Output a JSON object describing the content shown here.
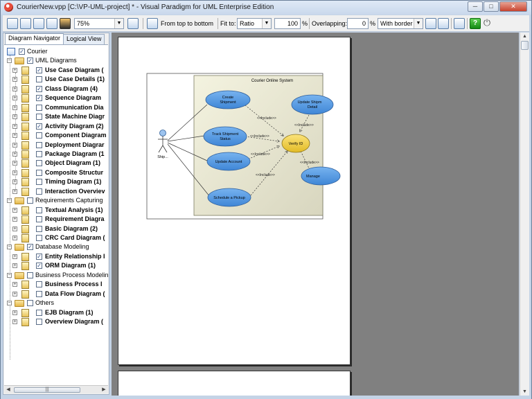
{
  "window": {
    "title": "CourierNew.vpp [C:\\VP-UML-project] * - Visual Paradigm for UML Enterprise Edition",
    "min_glyph": "─",
    "max_glyph": "□",
    "close_glyph": "✕"
  },
  "toolbar": {
    "zoom_value": "75%",
    "layout_label": "From top to bottom",
    "fit_label": "Fit to:",
    "fit_value": "Ratio",
    "fit_percent_value": "100",
    "percent_sign": "%",
    "overlap_label": "Overlapping:",
    "overlap_value": "0",
    "overlap_percent_sign": "%",
    "border_value": "With border",
    "help_glyph": "?",
    "power_glyph": "⏻",
    "dropdown_glyph": "▼"
  },
  "navigator": {
    "tabs": [
      {
        "label": "Diagram Navigator"
      },
      {
        "label": "Logical View"
      }
    ],
    "root": {
      "label": "Courier",
      "checked": true
    },
    "groups": [
      {
        "label": "UML Diagrams",
        "checked": true
      },
      {
        "label": "Requirements Capturing",
        "checked": false
      },
      {
        "label": "Database Modeling",
        "checked": true
      },
      {
        "label": "Business Process Modeling",
        "checked": false
      },
      {
        "label": "Others",
        "checked": false
      }
    ],
    "items": [
      {
        "label": "Use Case Diagram (",
        "checked": true
      },
      {
        "label": "Use Case Details (1)",
        "checked": false
      },
      {
        "label": "Class Diagram (4)",
        "checked": true
      },
      {
        "label": "Sequence Diagram",
        "checked": true
      },
      {
        "label": "Communication Dia",
        "checked": false
      },
      {
        "label": "State Machine Diagr",
        "checked": false
      },
      {
        "label": "Activity Diagram (2)",
        "checked": true
      },
      {
        "label": "Component Diagram",
        "checked": false
      },
      {
        "label": "Deployment Diagrar",
        "checked": false
      },
      {
        "label": "Package Diagram (1",
        "checked": false
      },
      {
        "label": "Object Diagram (1)",
        "checked": false
      },
      {
        "label": "Composite Structur",
        "checked": false
      },
      {
        "label": "Timing Diagram (1)",
        "checked": false
      },
      {
        "label": "Interaction Overviev",
        "checked": false
      },
      {
        "label": "Textual Analysis (1)",
        "checked": false
      },
      {
        "label": "Requirement Diagra",
        "checked": false
      },
      {
        "label": "Basic Diagram (2)",
        "checked": false
      },
      {
        "label": "CRC Card Diagram (",
        "checked": false
      },
      {
        "label": "Entity Relationship I",
        "checked": true
      },
      {
        "label": "ORM Diagram (1)",
        "checked": true
      },
      {
        "label": "Business Process I",
        "checked": false
      },
      {
        "label": "Data Flow Diagram (",
        "checked": false
      },
      {
        "label": "EJB Diagram (1)",
        "checked": false
      },
      {
        "label": "Overview Diagram (",
        "checked": false
      }
    ],
    "check_glyph": "✓",
    "expand_glyph": "+",
    "collapse_glyph": "−",
    "scroll_left": "◀",
    "scroll_right": "▶",
    "scroll_grip": "|||"
  },
  "diagram": {
    "system_label": "Courier Online System",
    "actor_label": "Ship...",
    "use_cases": [
      {
        "label_lines": [
          "Create",
          "Shipment"
        ]
      },
      {
        "label_lines": [
          "Track Shipment",
          "Status"
        ]
      },
      {
        "label_lines": [
          "Update Account"
        ]
      },
      {
        "label_lines": [
          "Schedule a Pickup"
        ]
      },
      {
        "label_lines": [
          "Update Shipm",
          "Detail"
        ]
      },
      {
        "label_lines": [
          "Verify ID"
        ]
      },
      {
        "label_lines": [
          "Manage"
        ]
      }
    ],
    "include_label": "<<Include>>"
  },
  "scrollbar": {
    "up": "▲",
    "down": "▼"
  }
}
